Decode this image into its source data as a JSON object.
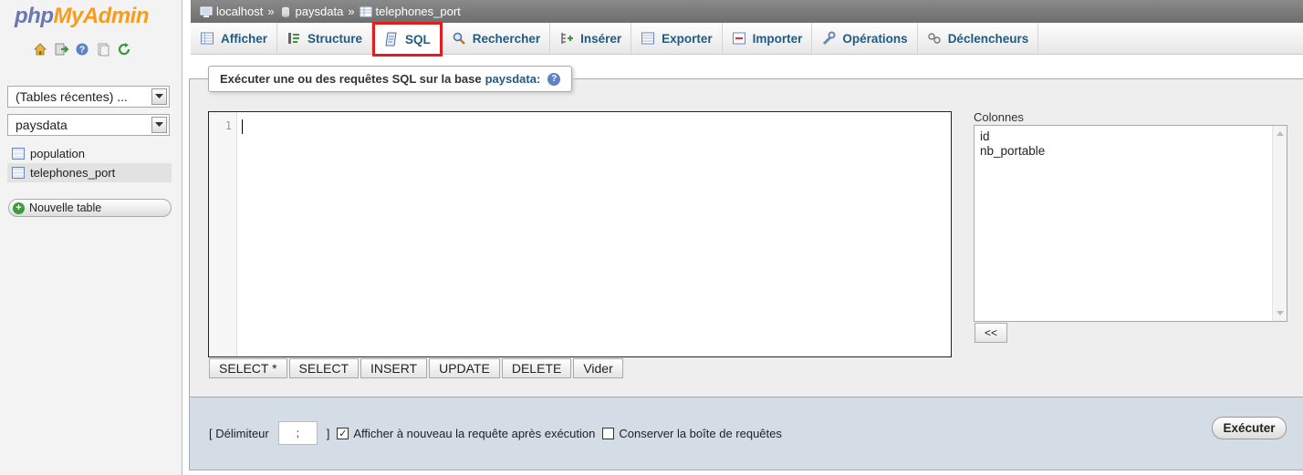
{
  "logo": {
    "part1": "php",
    "part2": "MyAdmin"
  },
  "left": {
    "recent_tables": "(Tables récentes) ...",
    "database": "paysdata",
    "tables": [
      {
        "name": "population"
      },
      {
        "name": "telephones_port"
      }
    ],
    "new_table": "Nouvelle table"
  },
  "breadcrumb": {
    "server": "localhost",
    "database": "paysdata",
    "table": "telephones_port",
    "separator": "»"
  },
  "tabs": [
    {
      "label": "Afficher"
    },
    {
      "label": "Structure"
    },
    {
      "label": "SQL"
    },
    {
      "label": "Rechercher"
    },
    {
      "label": "Insérer"
    },
    {
      "label": "Exporter"
    },
    {
      "label": "Importer"
    },
    {
      "label": "Opérations"
    },
    {
      "label": "Déclencheurs"
    }
  ],
  "sql": {
    "legend": "Exécuter une ou des requêtes SQL sur la base",
    "legend_db": "paysdata:",
    "line_number": "1",
    "buttons": [
      "SELECT *",
      "SELECT",
      "INSERT",
      "UPDATE",
      "DELETE",
      "Vider"
    ],
    "columns_label": "Colonnes",
    "columns": [
      "id",
      "nb_portable"
    ],
    "insert_button": "<<"
  },
  "footer": {
    "delimiter_open": "[ Délimiteur",
    "delimiter_value": ";",
    "delimiter_close": "]",
    "show_again": "Afficher à nouveau la requête après exécution",
    "keep_box": "Conserver la boîte de requêtes",
    "execute": "Exécuter"
  },
  "colors": {
    "accent": "#235a81",
    "highlight": "#e01e1e",
    "footer_bg": "#d4dce6"
  }
}
